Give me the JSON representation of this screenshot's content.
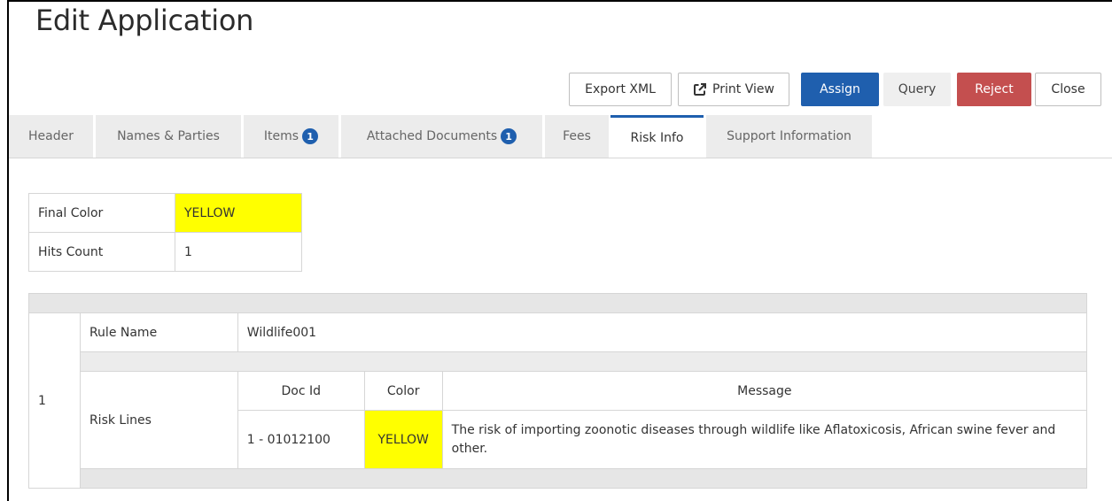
{
  "page": {
    "title": "Edit Application"
  },
  "toolbar": {
    "export_xml": "Export XML",
    "print_view": "Print View",
    "assign": "Assign",
    "query": "Query",
    "reject": "Reject",
    "close": "Close",
    "print_icon": "external-link-icon"
  },
  "tabs": [
    {
      "label": "Header"
    },
    {
      "label": "Names & Parties"
    },
    {
      "label": "Items",
      "badge": "1"
    },
    {
      "label": "Attached Documents",
      "badge": "1"
    },
    {
      "label": "Fees"
    },
    {
      "label": "Risk Info",
      "active": true
    },
    {
      "label": "Support Information"
    }
  ],
  "summary": {
    "final_color_label": "Final Color",
    "final_color_value": "YELLOW",
    "hits_count_label": "Hits Count",
    "hits_count_value": "1"
  },
  "risk": {
    "index": "1",
    "rule_name_label": "Rule Name",
    "rule_name_value": "Wildlife001",
    "risk_lines_label": "Risk Lines",
    "columns": [
      "Doc Id",
      "Color",
      "Message"
    ],
    "rows": [
      {
        "doc_id": "1 - 01012100",
        "color": "YELLOW",
        "message": "The risk of importing zoonotic diseases through wildlife like Aflatoxicosis, African swine fever and other."
      }
    ]
  },
  "colors": {
    "primary": "#1f5fae",
    "danger": "#c44f4f",
    "highlight": "#ffff00"
  }
}
